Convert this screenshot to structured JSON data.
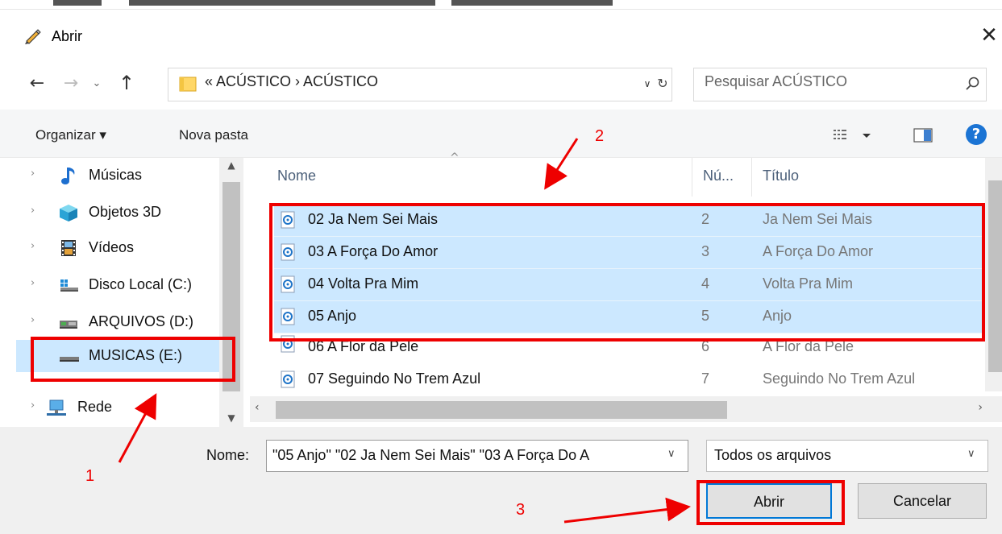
{
  "window": {
    "title": "Abrir",
    "close_glyph": "✕"
  },
  "nav": {
    "back_glyph": "←",
    "forward_glyph": "→",
    "recent_glyph": "⌄",
    "up_glyph": "↑",
    "address_path": "« ACÚSTICO › ACÚSTICO",
    "address_dropdown_glyph": "∨",
    "refresh_glyph": "↻",
    "search_placeholder": "Pesquisar ACÚSTICO"
  },
  "toolbar": {
    "organize_label": "Organizar ▾",
    "new_folder_label": "Nova pasta",
    "help_glyph": "?"
  },
  "sidebar": {
    "items": [
      {
        "label": "Músicas",
        "icon": "music-note-icon"
      },
      {
        "label": "Objetos 3D",
        "icon": "cube-3d-icon"
      },
      {
        "label": "Vídeos",
        "icon": "film-icon"
      },
      {
        "label": "Disco Local (C:)",
        "icon": "windows-drive-icon"
      },
      {
        "label": "ARQUIVOS (D:)",
        "icon": "network-drive-icon"
      },
      {
        "label": "MUSICAS (E:)",
        "icon": "drive-icon",
        "selected": true
      },
      {
        "label": "Rede",
        "icon": "network-icon"
      }
    ]
  },
  "filelist": {
    "columns": [
      "Nome",
      "Nú...",
      "Título"
    ],
    "rows": [
      {
        "name": "02 Ja Nem Sei Mais",
        "number": "2",
        "title": "Ja Nem Sei Mais",
        "selected": true
      },
      {
        "name": "03 A Força Do Amor",
        "number": "3",
        "title": "A Força Do Amor",
        "selected": true
      },
      {
        "name": "04 Volta Pra Mim",
        "number": "4",
        "title": "Volta Pra Mim",
        "selected": true
      },
      {
        "name": "05 Anjo",
        "number": "5",
        "title": "Anjo",
        "selected": true
      },
      {
        "name": "06 A Flor da Pele",
        "number": "6",
        "title": "A Flor da Pele",
        "selected": false
      },
      {
        "name": "07 Seguindo No Trem Azul",
        "number": "7",
        "title": "Seguindo No Trem Azul",
        "selected": false
      }
    ]
  },
  "bottom": {
    "filename_label": "Nome:",
    "filename_value": "\"05 Anjo\" \"02 Ja Nem Sei Mais\" \"03 A Força Do A",
    "filetype_value": "Todos os arquivos",
    "dropdown_glyph": "∨",
    "open_label": "Abrir",
    "cancel_label": "Cancelar"
  },
  "annotations": {
    "label_1": "1",
    "label_2": "2",
    "label_3": "3",
    "color": "#ee0000"
  },
  "colors": {
    "selection": "#cce8ff",
    "accent": "#0078d7",
    "help": "#1b74d4"
  }
}
